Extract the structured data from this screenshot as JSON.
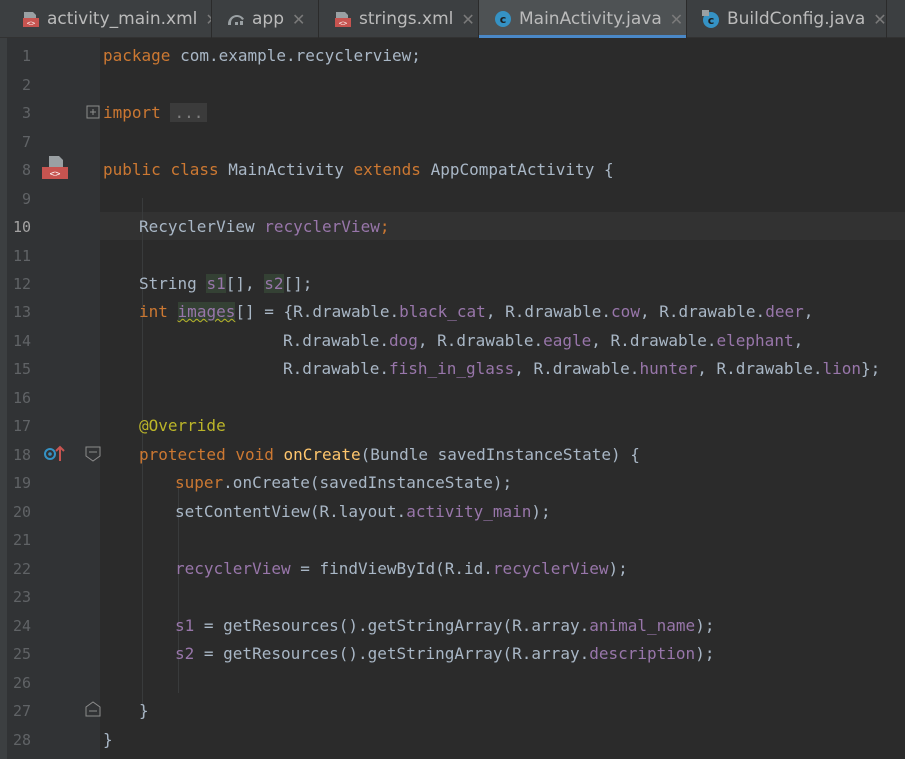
{
  "tabs": [
    {
      "label": "activity_main.xml",
      "icon": "layout-xml-icon",
      "active": false
    },
    {
      "label": "app",
      "icon": "android-gradle-icon",
      "active": false
    },
    {
      "label": "strings.xml",
      "icon": "values-xml-icon",
      "active": false
    },
    {
      "label": "MainActivity.java",
      "icon": "java-class-icon",
      "active": true
    },
    {
      "label": "BuildConfig.java",
      "icon": "java-class-locked-icon",
      "active": false
    }
  ],
  "close_glyph": "✕",
  "line_numbers": [
    "1",
    "2",
    "3",
    "7",
    "8",
    "9",
    "10",
    "11",
    "12",
    "13",
    "14",
    "15",
    "16",
    "17",
    "18",
    "19",
    "20",
    "21",
    "22",
    "23",
    "24",
    "25",
    "26",
    "27",
    "28"
  ],
  "current_line": "10",
  "code": {
    "l1": {
      "kw": "package",
      "rest": " com.example.recyclerview;"
    },
    "l3": {
      "kw": "import",
      "fold": "..."
    },
    "l8": {
      "kw1": "public",
      "kw2": "class",
      "name": "MainActivity",
      "kw3": "extends",
      "parent": "AppCompatActivity",
      "brace": "{"
    },
    "l10": {
      "type": "RecyclerView",
      "field": "recyclerView",
      "semi": ";"
    },
    "l12": {
      "type": "String",
      "f1": "s1",
      "mid": "[], ",
      "f2": "s2",
      "end": "[];"
    },
    "l13": {
      "kw": "int",
      "field": "images",
      "rest": "[] = {R.drawable.",
      "v1": "black_cat",
      "s1": ", R.drawable.",
      "v2": "cow",
      "s2": ", R.drawable.",
      "v3": "deer",
      "end": ","
    },
    "l14": {
      "p1": "R.drawable.",
      "v1": "dog",
      "s1": ", R.drawable.",
      "v2": "eagle",
      "s2": ", R.drawable.",
      "v3": "elephant",
      "end": ","
    },
    "l15": {
      "p1": "R.drawable.",
      "v1": "fish_in_glass",
      "s1": ", R.drawable.",
      "v2": "hunter",
      "s2": ", R.drawable.",
      "v3": "lion",
      "end": "};"
    },
    "l17": {
      "ann": "@Override"
    },
    "l18": {
      "kw1": "protected",
      "kw2": "void",
      "method": "onCreate",
      "rest": "(Bundle savedInstanceState) {"
    },
    "l19": {
      "kw": "super",
      "rest": ".onCreate(savedInstanceState);"
    },
    "l20": {
      "p1": "setContentView(R.layout.",
      "field": "activity_main",
      "end": ");"
    },
    "l22": {
      "field": "recyclerView",
      "p1": " = findViewById(R.id.",
      "field2": "recyclerView",
      "end": ");"
    },
    "l24": {
      "field": "s1",
      "p1": " = getResources().getStringArray(R.array.",
      "field2": "animal_name",
      "end": ");"
    },
    "l25": {
      "field": "s2",
      "p1": " = getResources().getStringArray(R.array.",
      "field2": "description",
      "end": ");"
    },
    "l27": {
      "brace": "}"
    },
    "l28": {
      "brace": "}"
    }
  },
  "colors": {
    "background": "#2b2b2b",
    "gutter": "#313335",
    "keyword": "#cc7832",
    "field": "#9876aa",
    "annotation": "#bbb529",
    "method": "#ffc66d",
    "text": "#a9b7c6",
    "tab_accent": "#4a88c7"
  }
}
